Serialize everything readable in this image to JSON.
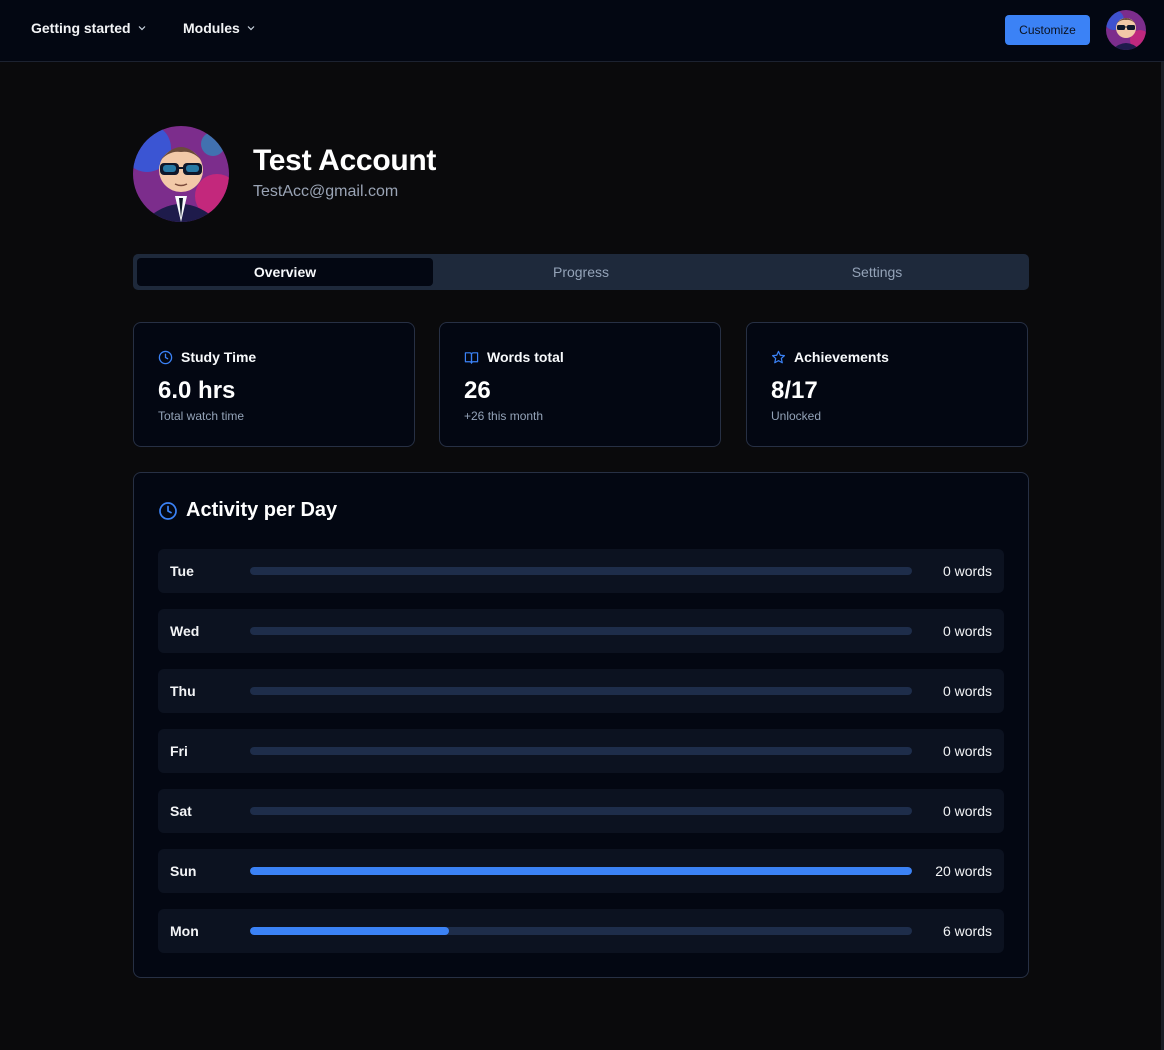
{
  "nav": {
    "items": [
      {
        "label": "Getting started"
      },
      {
        "label": "Modules"
      }
    ],
    "customize_label": "Customize"
  },
  "profile": {
    "name": "Test Account",
    "email": "TestAcc@gmail.com"
  },
  "tabs": [
    {
      "label": "Overview",
      "active": true
    },
    {
      "label": "Progress",
      "active": false
    },
    {
      "label": "Settings",
      "active": false
    }
  ],
  "stats": [
    {
      "icon": "clock-icon",
      "title": "Study Time",
      "value": "6.0 hrs",
      "sub": "Total watch time"
    },
    {
      "icon": "book-open-icon",
      "title": "Words total",
      "value": "26",
      "sub": "+26 this month"
    },
    {
      "icon": "star-icon",
      "title": "Achievements",
      "value": "8/17",
      "sub": "Unlocked"
    }
  ],
  "activity": {
    "title": "Activity per Day",
    "max_words": 20,
    "days": [
      {
        "day": "Tue",
        "words": 0,
        "label": "0 words"
      },
      {
        "day": "Wed",
        "words": 0,
        "label": "0 words"
      },
      {
        "day": "Thu",
        "words": 0,
        "label": "0 words"
      },
      {
        "day": "Fri",
        "words": 0,
        "label": "0 words"
      },
      {
        "day": "Sat",
        "words": 0,
        "label": "0 words"
      },
      {
        "day": "Sun",
        "words": 20,
        "label": "20 words"
      },
      {
        "day": "Mon",
        "words": 6,
        "label": "6 words"
      }
    ]
  },
  "colors": {
    "accent": "#3b82f6",
    "background": "#0a0a0c",
    "card": "#030712"
  }
}
